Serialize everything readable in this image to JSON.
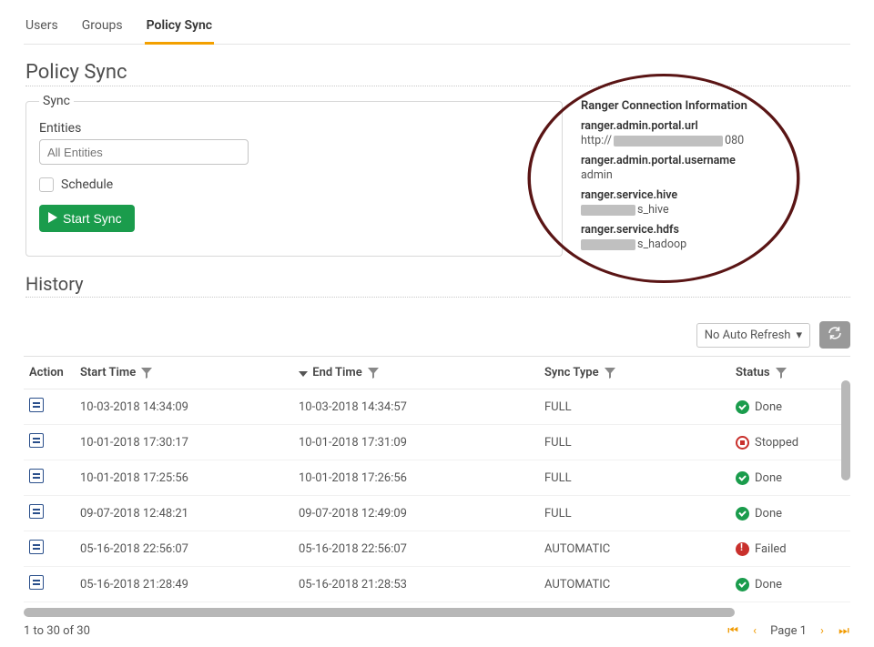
{
  "tabs": {
    "users": "Users",
    "groups": "Groups",
    "policy_sync": "Policy Sync"
  },
  "page": {
    "title": "Policy Sync",
    "history_title": "History"
  },
  "sync": {
    "legend": "Sync",
    "entities_label": "Entities",
    "entities_placeholder": "All Entities",
    "schedule_label": "Schedule",
    "start_button": "Start Sync"
  },
  "info": {
    "heading": "Ranger Connection Information",
    "portal_url_key": "ranger.admin.portal.url",
    "portal_url_prefix": "http://",
    "portal_url_port": "080",
    "portal_user_key": "ranger.admin.portal.username",
    "portal_user_val": "admin",
    "hive_key": "ranger.service.hive",
    "hive_suffix": "s_hive",
    "hdfs_key": "ranger.service.hdfs",
    "hdfs_suffix": "s_hadoop"
  },
  "toolbar": {
    "refresh_select": "No Auto Refresh"
  },
  "columns": {
    "action": "Action",
    "start": "Start Time",
    "end": "End Time",
    "type": "Sync Type",
    "status": "Status"
  },
  "rows": [
    {
      "start": "10-03-2018 14:34:09",
      "end": "10-03-2018 14:34:57",
      "type": "FULL",
      "status": "Done",
      "status_kind": "done"
    },
    {
      "start": "10-01-2018 17:30:17",
      "end": "10-01-2018 17:31:09",
      "type": "FULL",
      "status": "Stopped",
      "status_kind": "stopped"
    },
    {
      "start": "10-01-2018 17:25:56",
      "end": "10-01-2018 17:26:56",
      "type": "FULL",
      "status": "Done",
      "status_kind": "done"
    },
    {
      "start": "09-07-2018 12:48:21",
      "end": "09-07-2018 12:49:09",
      "type": "FULL",
      "status": "Done",
      "status_kind": "done"
    },
    {
      "start": "05-16-2018 22:56:07",
      "end": "05-16-2018 22:56:07",
      "type": "AUTOMATIC",
      "status": "Failed",
      "status_kind": "failed"
    },
    {
      "start": "05-16-2018 21:28:49",
      "end": "05-16-2018 21:28:53",
      "type": "AUTOMATIC",
      "status": "Done",
      "status_kind": "done"
    }
  ],
  "pager": {
    "summary": "1 to 30 of 30",
    "page_label": "Page 1"
  }
}
